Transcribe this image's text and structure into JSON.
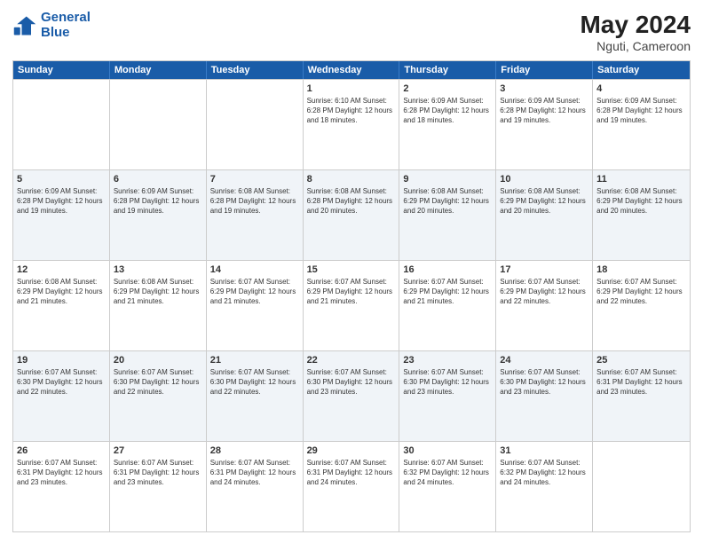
{
  "logo": {
    "line1": "General",
    "line2": "Blue"
  },
  "title": {
    "month_year": "May 2024",
    "location": "Nguti, Cameroon"
  },
  "days_of_week": [
    "Sunday",
    "Monday",
    "Tuesday",
    "Wednesday",
    "Thursday",
    "Friday",
    "Saturday"
  ],
  "rows": [
    {
      "alt": false,
      "cells": [
        {
          "date": "",
          "info": ""
        },
        {
          "date": "",
          "info": ""
        },
        {
          "date": "",
          "info": ""
        },
        {
          "date": "1",
          "info": "Sunrise: 6:10 AM\nSunset: 6:28 PM\nDaylight: 12 hours\nand 18 minutes."
        },
        {
          "date": "2",
          "info": "Sunrise: 6:09 AM\nSunset: 6:28 PM\nDaylight: 12 hours\nand 18 minutes."
        },
        {
          "date": "3",
          "info": "Sunrise: 6:09 AM\nSunset: 6:28 PM\nDaylight: 12 hours\nand 19 minutes."
        },
        {
          "date": "4",
          "info": "Sunrise: 6:09 AM\nSunset: 6:28 PM\nDaylight: 12 hours\nand 19 minutes."
        }
      ]
    },
    {
      "alt": true,
      "cells": [
        {
          "date": "5",
          "info": "Sunrise: 6:09 AM\nSunset: 6:28 PM\nDaylight: 12 hours\nand 19 minutes."
        },
        {
          "date": "6",
          "info": "Sunrise: 6:09 AM\nSunset: 6:28 PM\nDaylight: 12 hours\nand 19 minutes."
        },
        {
          "date": "7",
          "info": "Sunrise: 6:08 AM\nSunset: 6:28 PM\nDaylight: 12 hours\nand 19 minutes."
        },
        {
          "date": "8",
          "info": "Sunrise: 6:08 AM\nSunset: 6:28 PM\nDaylight: 12 hours\nand 20 minutes."
        },
        {
          "date": "9",
          "info": "Sunrise: 6:08 AM\nSunset: 6:29 PM\nDaylight: 12 hours\nand 20 minutes."
        },
        {
          "date": "10",
          "info": "Sunrise: 6:08 AM\nSunset: 6:29 PM\nDaylight: 12 hours\nand 20 minutes."
        },
        {
          "date": "11",
          "info": "Sunrise: 6:08 AM\nSunset: 6:29 PM\nDaylight: 12 hours\nand 20 minutes."
        }
      ]
    },
    {
      "alt": false,
      "cells": [
        {
          "date": "12",
          "info": "Sunrise: 6:08 AM\nSunset: 6:29 PM\nDaylight: 12 hours\nand 21 minutes."
        },
        {
          "date": "13",
          "info": "Sunrise: 6:08 AM\nSunset: 6:29 PM\nDaylight: 12 hours\nand 21 minutes."
        },
        {
          "date": "14",
          "info": "Sunrise: 6:07 AM\nSunset: 6:29 PM\nDaylight: 12 hours\nand 21 minutes."
        },
        {
          "date": "15",
          "info": "Sunrise: 6:07 AM\nSunset: 6:29 PM\nDaylight: 12 hours\nand 21 minutes."
        },
        {
          "date": "16",
          "info": "Sunrise: 6:07 AM\nSunset: 6:29 PM\nDaylight: 12 hours\nand 21 minutes."
        },
        {
          "date": "17",
          "info": "Sunrise: 6:07 AM\nSunset: 6:29 PM\nDaylight: 12 hours\nand 22 minutes."
        },
        {
          "date": "18",
          "info": "Sunrise: 6:07 AM\nSunset: 6:29 PM\nDaylight: 12 hours\nand 22 minutes."
        }
      ]
    },
    {
      "alt": true,
      "cells": [
        {
          "date": "19",
          "info": "Sunrise: 6:07 AM\nSunset: 6:30 PM\nDaylight: 12 hours\nand 22 minutes."
        },
        {
          "date": "20",
          "info": "Sunrise: 6:07 AM\nSunset: 6:30 PM\nDaylight: 12 hours\nand 22 minutes."
        },
        {
          "date": "21",
          "info": "Sunrise: 6:07 AM\nSunset: 6:30 PM\nDaylight: 12 hours\nand 22 minutes."
        },
        {
          "date": "22",
          "info": "Sunrise: 6:07 AM\nSunset: 6:30 PM\nDaylight: 12 hours\nand 23 minutes."
        },
        {
          "date": "23",
          "info": "Sunrise: 6:07 AM\nSunset: 6:30 PM\nDaylight: 12 hours\nand 23 minutes."
        },
        {
          "date": "24",
          "info": "Sunrise: 6:07 AM\nSunset: 6:30 PM\nDaylight: 12 hours\nand 23 minutes."
        },
        {
          "date": "25",
          "info": "Sunrise: 6:07 AM\nSunset: 6:31 PM\nDaylight: 12 hours\nand 23 minutes."
        }
      ]
    },
    {
      "alt": false,
      "cells": [
        {
          "date": "26",
          "info": "Sunrise: 6:07 AM\nSunset: 6:31 PM\nDaylight: 12 hours\nand 23 minutes."
        },
        {
          "date": "27",
          "info": "Sunrise: 6:07 AM\nSunset: 6:31 PM\nDaylight: 12 hours\nand 23 minutes."
        },
        {
          "date": "28",
          "info": "Sunrise: 6:07 AM\nSunset: 6:31 PM\nDaylight: 12 hours\nand 24 minutes."
        },
        {
          "date": "29",
          "info": "Sunrise: 6:07 AM\nSunset: 6:31 PM\nDaylight: 12 hours\nand 24 minutes."
        },
        {
          "date": "30",
          "info": "Sunrise: 6:07 AM\nSunset: 6:32 PM\nDaylight: 12 hours\nand 24 minutes."
        },
        {
          "date": "31",
          "info": "Sunrise: 6:07 AM\nSunset: 6:32 PM\nDaylight: 12 hours\nand 24 minutes."
        },
        {
          "date": "",
          "info": ""
        }
      ]
    }
  ]
}
